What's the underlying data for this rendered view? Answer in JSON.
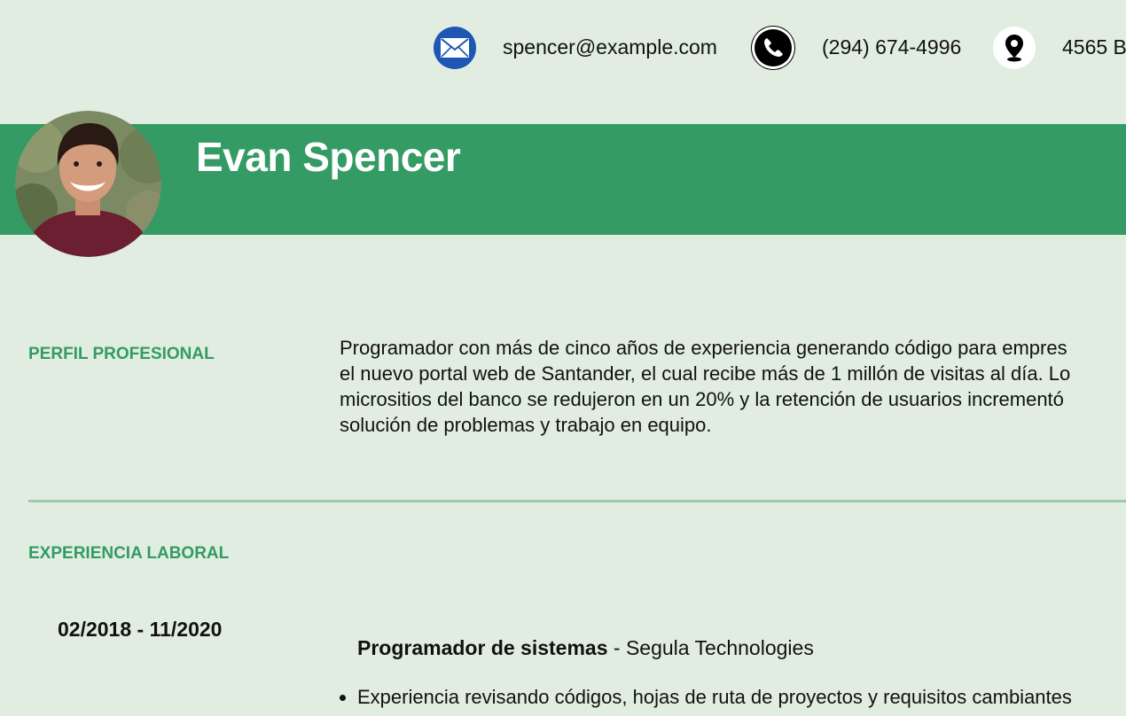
{
  "contact": {
    "email": "spencer@example.com",
    "phone": "(294) 674-4996",
    "address": "4565 B",
    "email_icon": "envelope-icon",
    "phone_icon": "phone-icon",
    "address_icon": "map-pin-icon"
  },
  "header": {
    "name": "Evan Spencer",
    "band_color": "#339b63"
  },
  "profile": {
    "label": "PERFIL PROFESIONAL",
    "lines": [
      "Programador con más de cinco años de experiencia generando código para empres",
      "el nuevo portal web de Santander, el cual recibe más de 1 millón de visitas al día. Lo",
      "micrositios del banco se redujeron en un 20% y la retención de usuarios incrementó",
      "solución de problemas y trabajo en equipo."
    ]
  },
  "experience": {
    "label": "EXPERIENCIA LABORAL",
    "jobs": [
      {
        "dates": "02/2018 - 11/2020",
        "title": "Programador de sistemas",
        "separator": " - ",
        "company": "Segula Technologies",
        "bullets": [
          "Experiencia revisando códigos, hojas de ruta de proyectos y requisitos cambiantes"
        ]
      }
    ]
  },
  "colors": {
    "background": "#e1ede1",
    "accent": "#339b63",
    "divider": "#9bcbac",
    "email_icon_bg": "#1d56b3"
  }
}
